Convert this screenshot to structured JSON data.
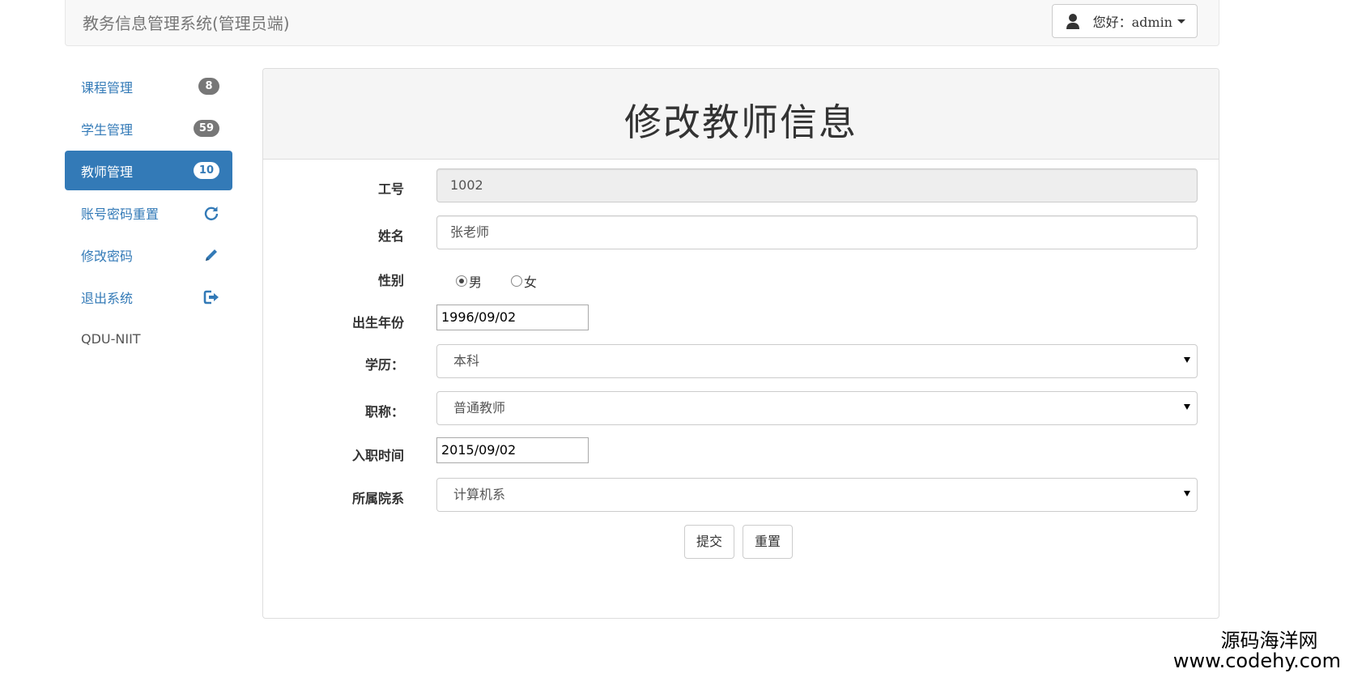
{
  "header": {
    "brand": "教务信息管理系统(管理员端)",
    "user_label": "您好：admin",
    "user_icon": "user-icon"
  },
  "sidebar": {
    "items": [
      {
        "label": "课程管理",
        "badge": "8"
      },
      {
        "label": "学生管理",
        "badge": "59"
      },
      {
        "label": "教师管理",
        "badge": "10",
        "active": true
      },
      {
        "label": "账号密码重置",
        "icon": "refresh-icon"
      },
      {
        "label": "修改密码",
        "icon": "pencil-icon"
      },
      {
        "label": "退出系统",
        "icon": "logout-icon"
      },
      {
        "label": "QDU-NIIT"
      }
    ]
  },
  "form": {
    "title": "修改教师信息",
    "fields": {
      "id": {
        "label": "工号",
        "value": "1002"
      },
      "name": {
        "label": "姓名",
        "value": "张老师"
      },
      "gender": {
        "label": "性别",
        "options": [
          "男",
          "女"
        ],
        "selected": "男"
      },
      "birth": {
        "label": "出生年份",
        "value": "1996/09/02"
      },
      "degree": {
        "label": "学历：",
        "value": "本科"
      },
      "title": {
        "label": "职称：",
        "value": "普通教师"
      },
      "hire": {
        "label": "入职时间",
        "value": "2015/09/02"
      },
      "dept": {
        "label": "所属院系",
        "value": "计算机系"
      }
    },
    "submit_label": "提交",
    "reset_label": "重置"
  },
  "watermark": {
    "line1": "源码海洋网",
    "line2": "www.codehy.com"
  },
  "colors": {
    "primary": "#337ab7",
    "badge": "#777777"
  }
}
